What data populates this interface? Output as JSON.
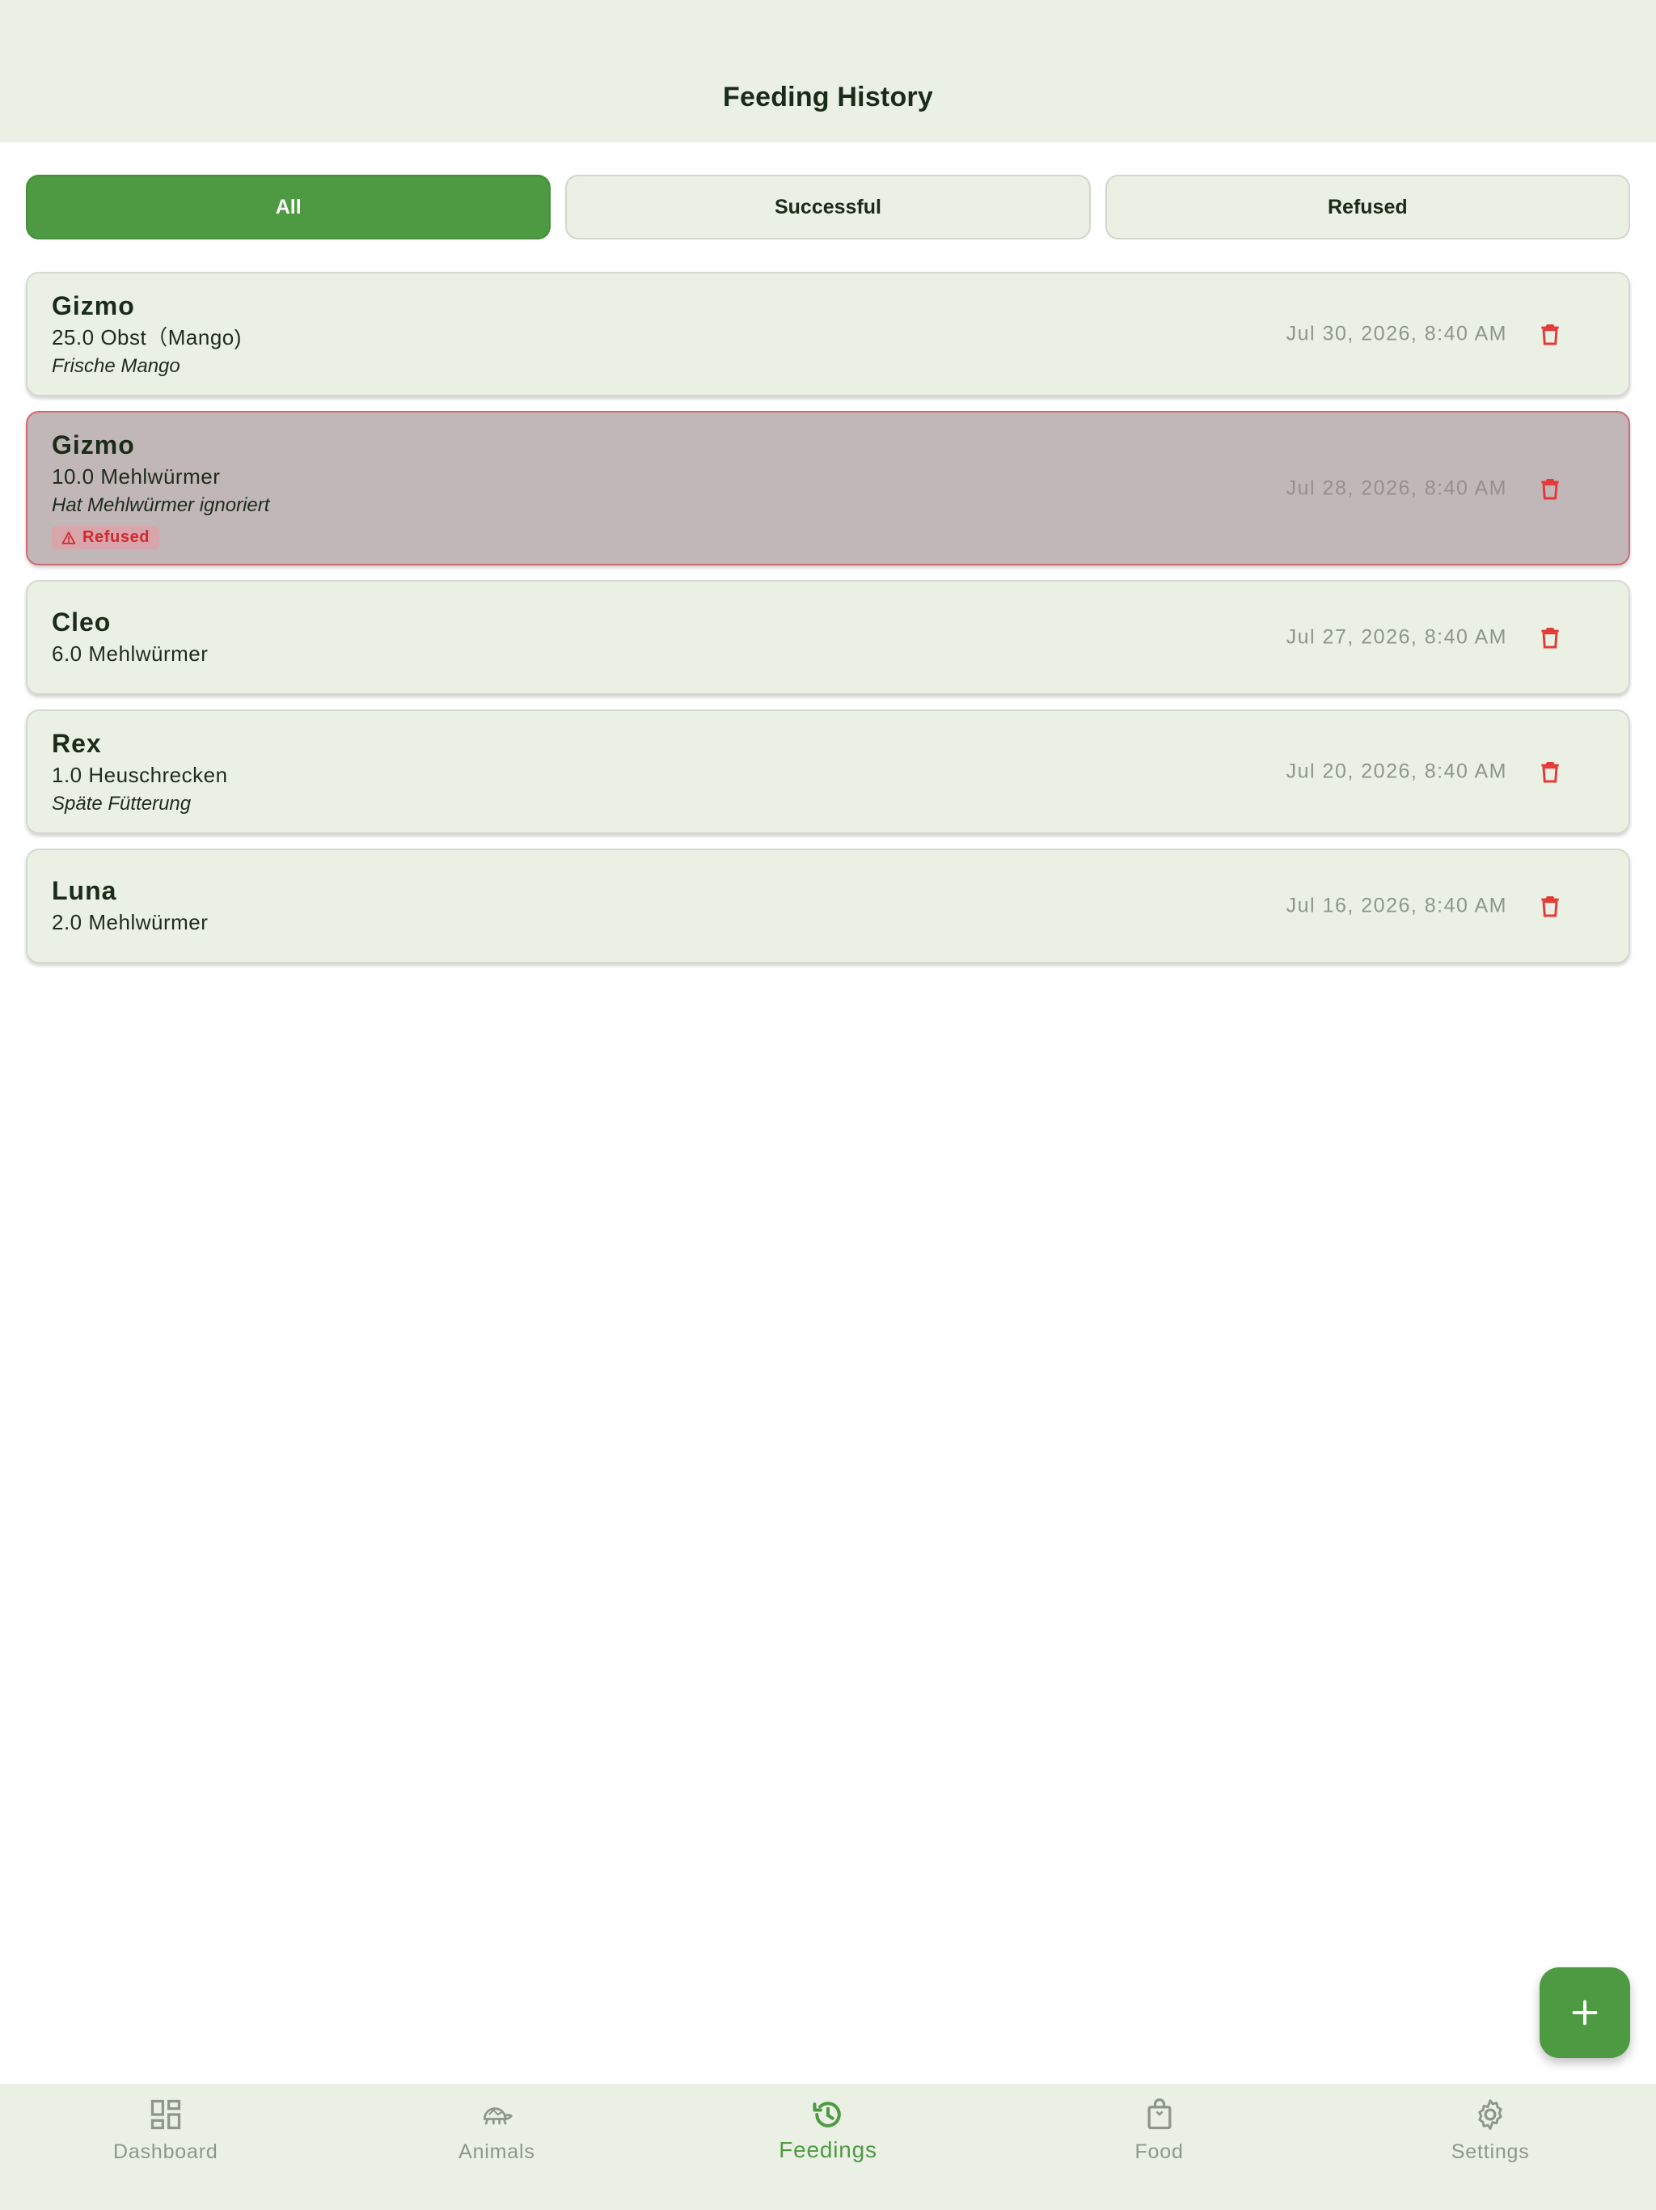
{
  "header": {
    "title": "Feeding History"
  },
  "filters": [
    {
      "label": "All",
      "active": true
    },
    {
      "label": "Successful",
      "active": false
    },
    {
      "label": "Refused",
      "active": false
    }
  ],
  "feedings": [
    {
      "name": "Gizmo",
      "amount": "25.0 Obst（Mango)",
      "note": "Frische Mango",
      "date": "Jul 30, 2026, 8:40 AM",
      "refused": false
    },
    {
      "name": "Gizmo",
      "amount": "10.0 Mehlwürmer",
      "note": "Hat Mehlwürmer ignoriert",
      "date": "Jul 28, 2026, 8:40 AM",
      "refused": true,
      "badge": "Refused"
    },
    {
      "name": "Cleo",
      "amount": "6.0 Mehlwürmer",
      "note": "",
      "date": "Jul 27, 2026, 8:40 AM",
      "refused": false
    },
    {
      "name": "Rex",
      "amount": "1.0 Heuschrecken",
      "note": "Späte Fütterung",
      "date": "Jul 20, 2026, 8:40 AM",
      "refused": false
    },
    {
      "name": "Luna",
      "amount": "2.0 Mehlwürmer",
      "note": "",
      "date": "Jul 16, 2026, 8:40 AM",
      "refused": false
    }
  ],
  "nav": [
    {
      "label": "Dashboard",
      "icon": "dashboard-icon",
      "active": false
    },
    {
      "label": "Animals",
      "icon": "turtle-icon",
      "active": false
    },
    {
      "label": "Feedings",
      "icon": "history-icon",
      "active": true
    },
    {
      "label": "Food",
      "icon": "bag-icon",
      "active": false
    },
    {
      "label": "Settings",
      "icon": "gear-icon",
      "active": false
    }
  ],
  "colors": {
    "accent": "#4e9a42",
    "danger": "#e53935",
    "surface": "#ebf0e5",
    "refused_card": "#c1b6b8"
  }
}
